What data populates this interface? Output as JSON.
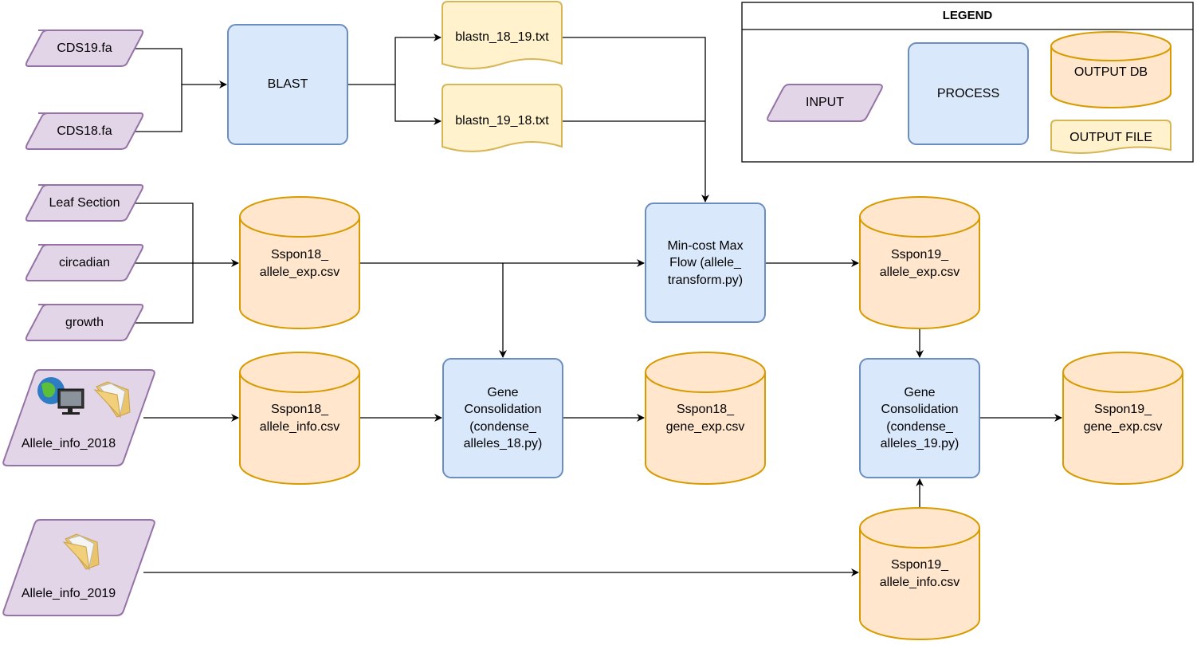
{
  "legend": {
    "title": "LEGEND",
    "input": "INPUT",
    "process": "PROCESS",
    "output_db": "OUTPUT DB",
    "output_file": "OUTPUT FILE"
  },
  "inputs": {
    "cds19": "CDS19.fa",
    "cds18": "CDS18.fa",
    "leaf": "Leaf Section",
    "circadian": "circadian",
    "growth": "growth",
    "allele2018": "Allele_info_2018",
    "allele2019": "Allele_info_2019"
  },
  "processes": {
    "blast": "BLAST",
    "mincost": [
      "Min-cost Max",
      "Flow (allele_",
      "transform.py)"
    ],
    "gc18": [
      "Gene",
      "Consolidation",
      "(condense_",
      "alleles_18.py)"
    ],
    "gc19": [
      "Gene",
      "Consolidation",
      "(condense_",
      "alleles_19.py)"
    ]
  },
  "files": {
    "b1819": "blastn_18_19.txt",
    "b1918": "blastn_19_18.txt"
  },
  "dbs": {
    "s18exp": [
      "Sspon18_",
      "allele_exp.csv"
    ],
    "s18info": [
      "Sspon18_",
      "allele_info.csv"
    ],
    "s18gene": [
      "Sspon18_",
      "gene_exp.csv"
    ],
    "s19exp": [
      "Sspon19_",
      "allele_exp.csv"
    ],
    "s19gene": [
      "Sspon19_",
      "gene_exp.csv"
    ],
    "s19info": [
      "Sspon19_",
      "allele_info.csv"
    ]
  },
  "colors": {
    "input_fill": "#e1d5e7",
    "input_stroke": "#9673a6",
    "process_fill": "#dae8fc",
    "process_stroke": "#6c8ebf",
    "db_fill": "#ffe6cc",
    "db_stroke": "#d79b00",
    "file_fill": "#fff2cc",
    "file_stroke": "#d6b656"
  }
}
